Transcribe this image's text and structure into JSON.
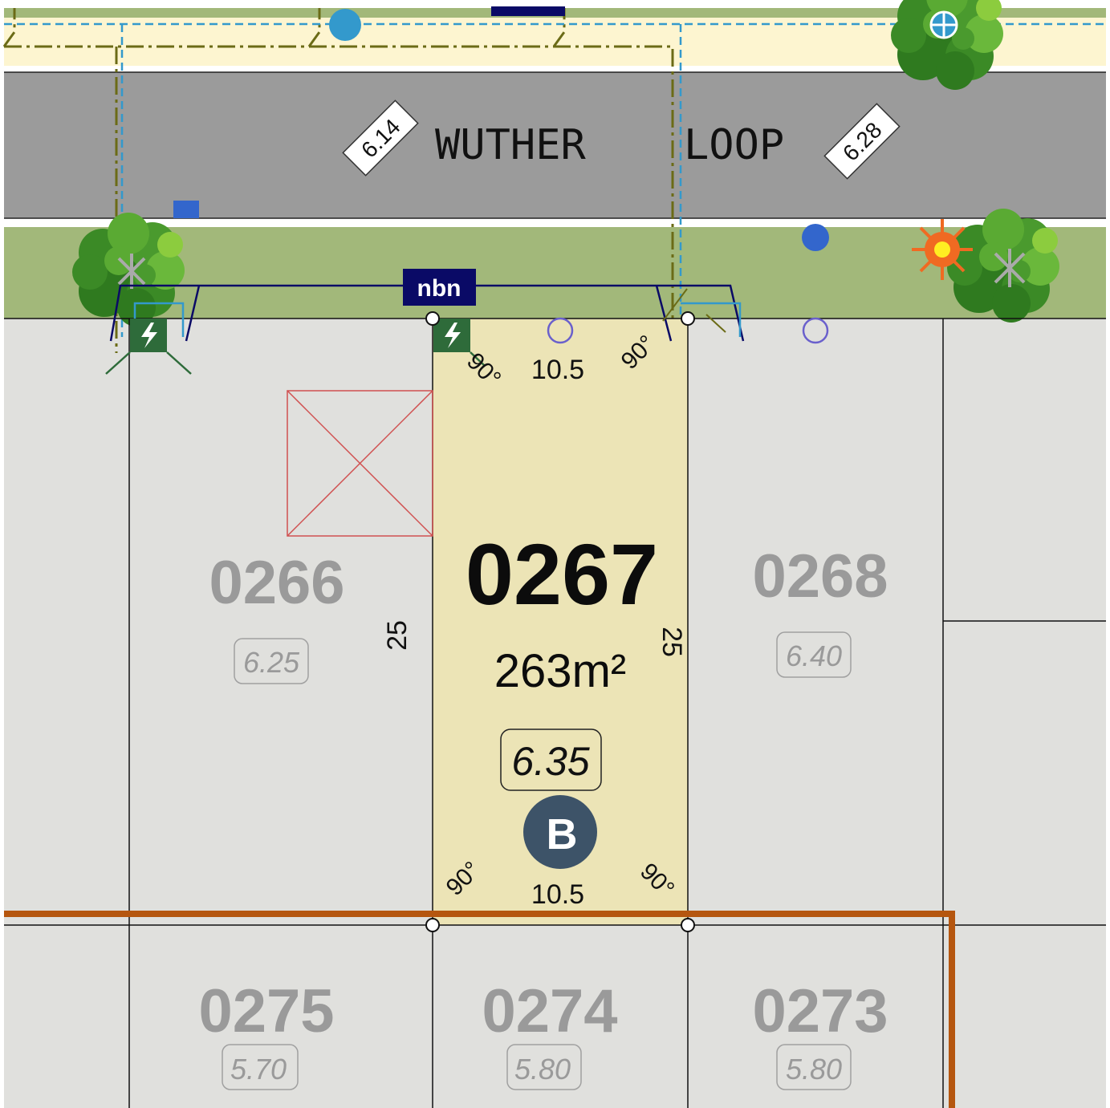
{
  "street": {
    "name_left": "WUTHER",
    "name_right": "LOOP"
  },
  "road_levels": [
    "6.14",
    "6.28"
  ],
  "service_label": "nbn",
  "main_lot": {
    "number": "0267",
    "area": "263m²",
    "level": "6.35",
    "badge": "B",
    "frontage": "10.5",
    "rear": "10.5",
    "depth_left": "25",
    "depth_right": "25",
    "angle_label": "90°"
  },
  "neighbour_lots": [
    {
      "number": "0266",
      "level": "6.25"
    },
    {
      "number": "0268",
      "level": "6.40"
    },
    {
      "number": "0275",
      "level": "5.70"
    },
    {
      "number": "0274",
      "level": "5.80"
    },
    {
      "number": "0273",
      "level": "5.80"
    }
  ],
  "colors": {
    "highlighted_lot": "#ece4b6",
    "other_lots": "#e0e0dd",
    "road": "#9b9b9b",
    "verge": "#a2b87a",
    "footpath": "#fdf5d0",
    "retaining_wall": "#b5560f",
    "badge": "#3d5368",
    "nbn": "#0a0a66",
    "water_line": "#3399cc",
    "gas_line": "#6b6b16"
  },
  "icons": [
    "tree-icon",
    "power-dome-icon",
    "street-light-icon",
    "water-meter-icon",
    "fire-hydrant-icon",
    "service-pit-icon",
    "sewer-pit-icon"
  ]
}
